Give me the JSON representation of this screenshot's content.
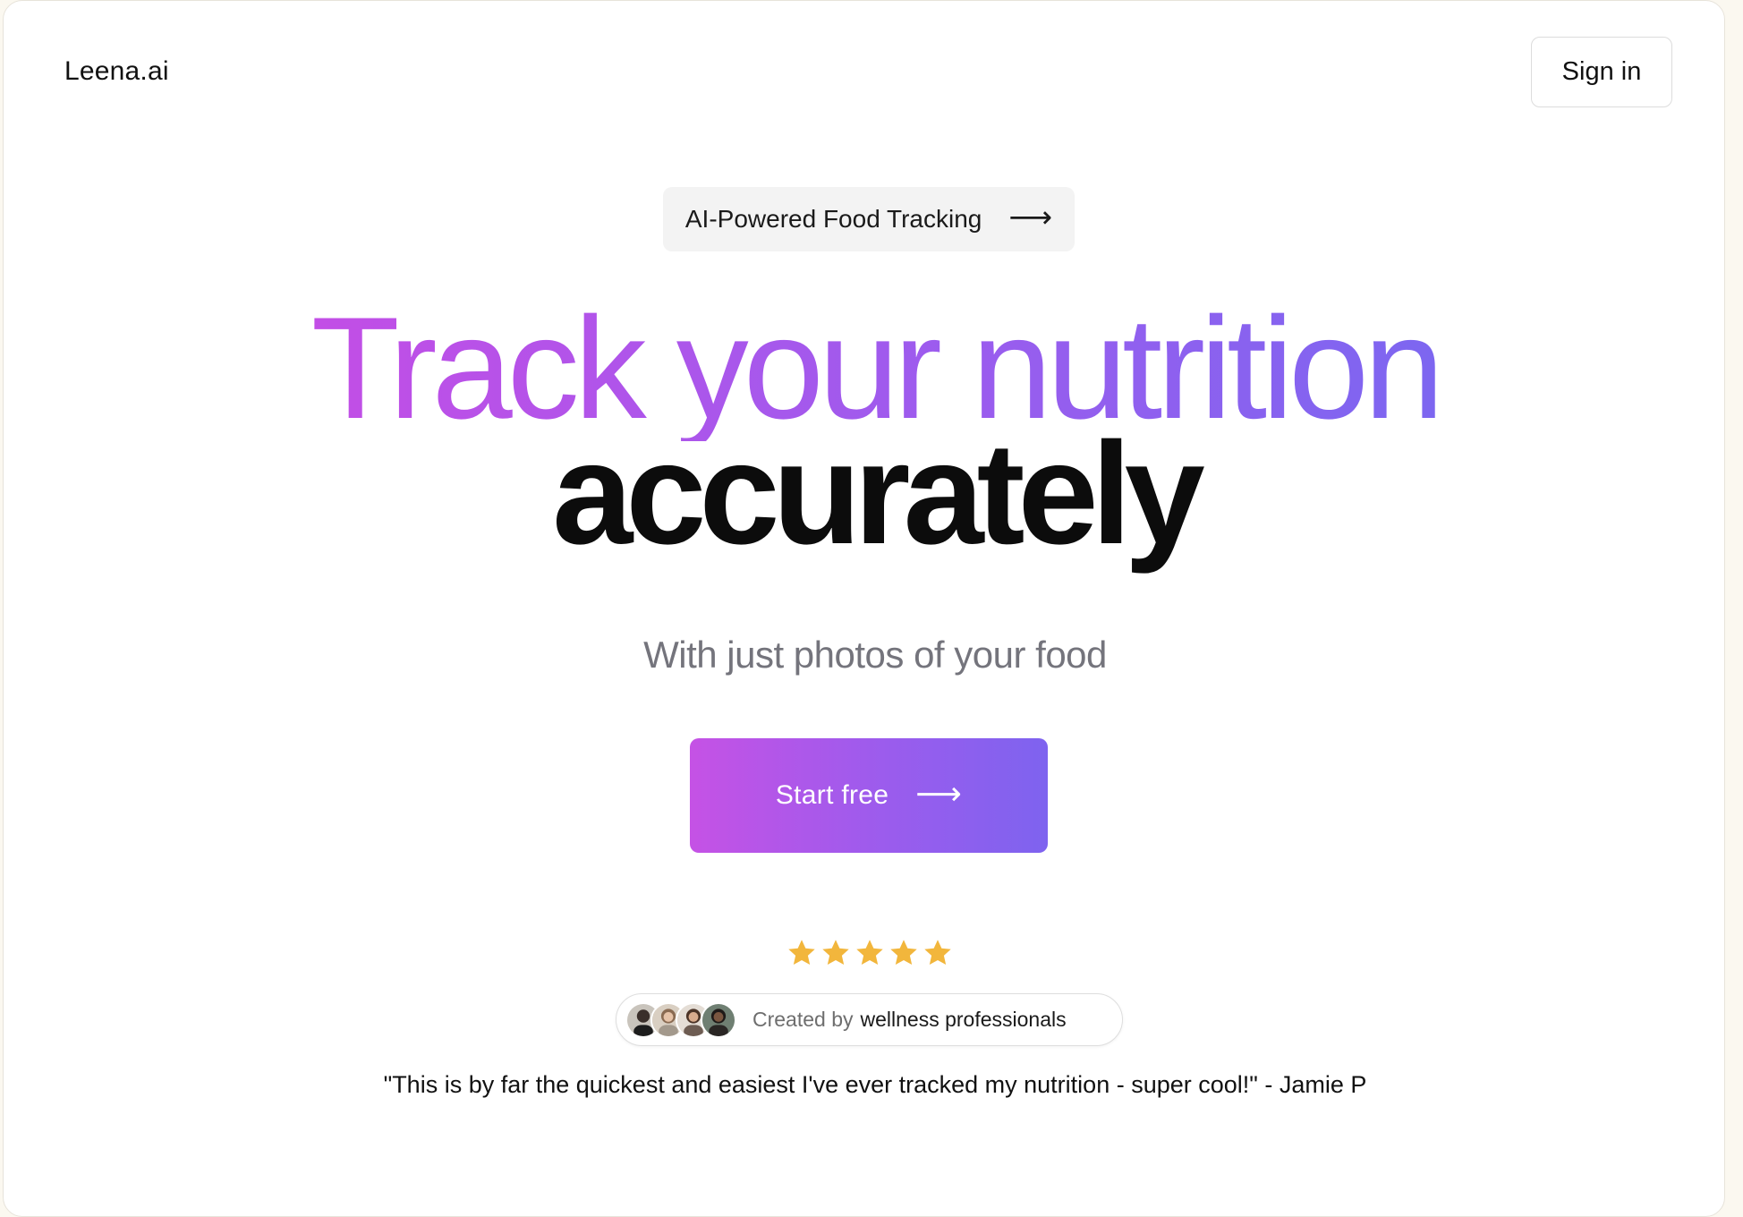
{
  "header": {
    "logo": "Leena.ai",
    "signin_label": "Sign in"
  },
  "hero": {
    "pill_label": "AI-Powered Food Tracking",
    "pill_icon": "arrow-right-icon",
    "headline_line1": "Track your nutrition",
    "headline_line2": "accurately",
    "subtitle": "With just photos of your food",
    "cta_label": "Start free",
    "cta_icon": "arrow-right-icon"
  },
  "social_proof": {
    "rating": 5,
    "rating_max": 5,
    "star_color": "#f2b63c",
    "badge_prefix": "Created by",
    "badge_emphasis": "wellness professionals",
    "avatars": [
      "avatar-1",
      "avatar-2",
      "avatar-3",
      "avatar-4"
    ],
    "quote": "\"This is by far the quickest and easiest I've ever tracked my nutrition - super cool!\" - Jamie P"
  },
  "colors": {
    "gradient_start": "#c552e5",
    "gradient_end": "#7e63ef"
  }
}
